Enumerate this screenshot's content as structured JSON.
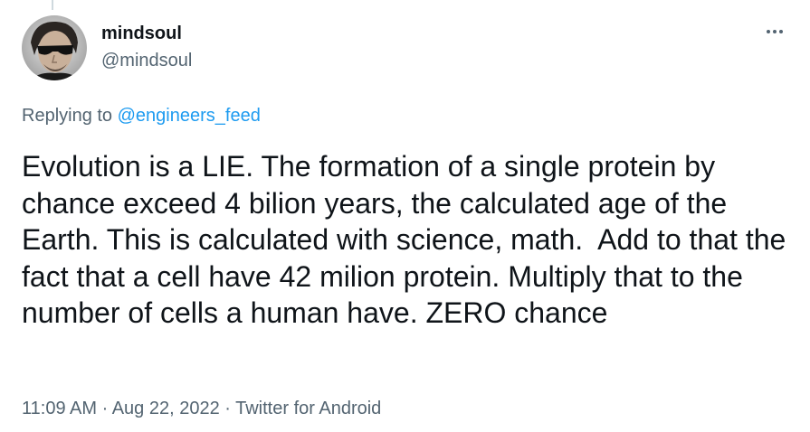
{
  "author": {
    "display_name": "mindsoul",
    "handle": "@mindsoul"
  },
  "reply": {
    "prefix": "Replying to ",
    "mention": "@engineers_feed"
  },
  "tweet": {
    "text": "Evolution is a LIE. The formation of a single protein by chance exceed 4 bilion years, the calculated age of the Earth. This is calculated with science, math.  Add to that the fact that a cell have 42 milion protein. Multiply that to the number of cells a human have. ZERO chance"
  },
  "meta": {
    "time": "11:09 AM",
    "separator": " · ",
    "date": "Aug 22, 2022",
    "source": "Twitter for Android"
  },
  "icons": {
    "more": "more-horizontal-icon",
    "avatar": "avatar-photo"
  },
  "colors": {
    "text_primary": "#0f1419",
    "text_secondary": "#536471",
    "link": "#1d9bf0"
  }
}
